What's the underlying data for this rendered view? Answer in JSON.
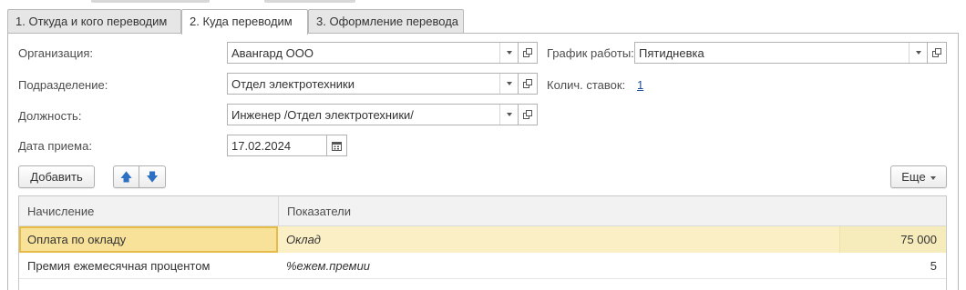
{
  "tabs": [
    {
      "label": "1. Откуда и кого переводим"
    },
    {
      "label": "2. Куда переводим"
    },
    {
      "label": "3. Оформление перевода"
    }
  ],
  "form": {
    "organization": {
      "label": "Организация:",
      "value": "Авангард ООО"
    },
    "department": {
      "label": "Подразделение:",
      "value": "Отдел электротехники"
    },
    "position": {
      "label": "Должность:",
      "value": "Инженер /Отдел электротехники/"
    },
    "hire_date": {
      "label": "Дата приема:",
      "value": "17.02.2024"
    },
    "schedule": {
      "label": "График работы:",
      "value": "Пятидневка"
    },
    "rates": {
      "label": "Колич. ставок:",
      "value": "1"
    }
  },
  "toolbar": {
    "add_label": "Добавить",
    "more_label": "Еще"
  },
  "table": {
    "columns": [
      "Начисление",
      "Показатели"
    ],
    "rows": [
      {
        "accrual": "Оплата по окладу",
        "indicator": "Оклад",
        "value": "75 000"
      },
      {
        "accrual": "Премия ежемесячная процентом",
        "indicator": "%ежем.премии",
        "value": "5"
      }
    ]
  },
  "colors": {
    "accent": "#2d6fc2",
    "selected_row": "#fbf0c5",
    "selected_cell_border": "#e7bb48",
    "link": "#1a4f95"
  }
}
